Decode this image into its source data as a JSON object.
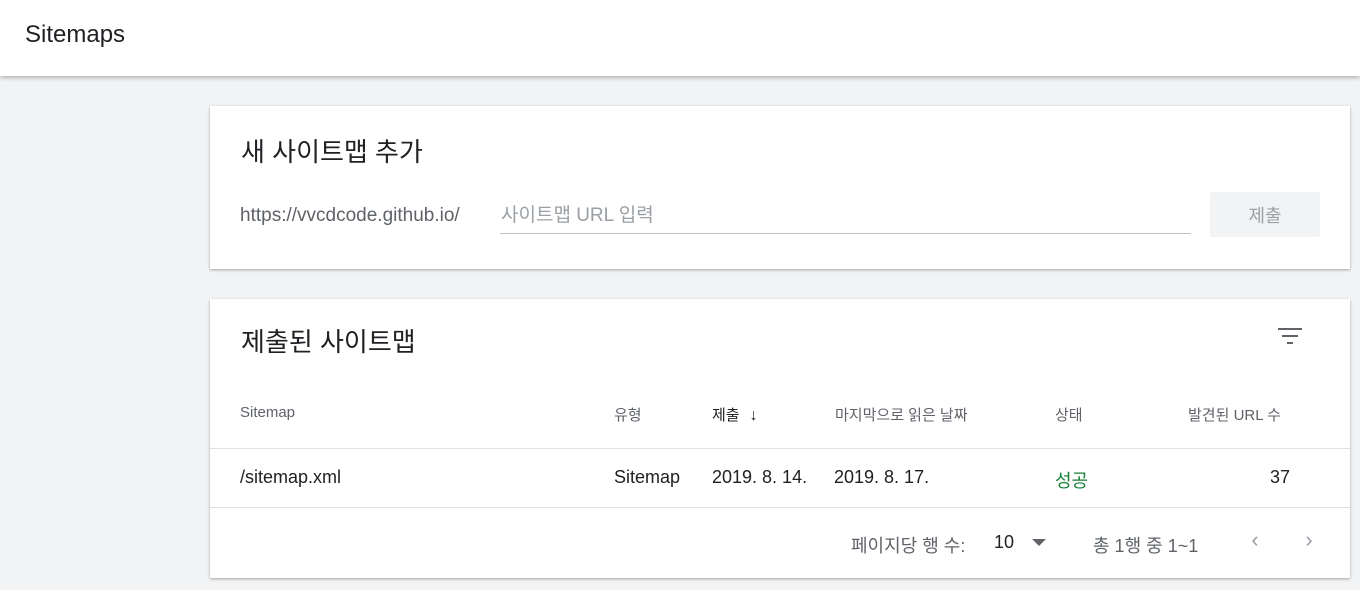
{
  "header": {
    "title": "Sitemaps"
  },
  "add_card": {
    "title": "새 사이트맵 추가",
    "url_prefix": "https://vvcdcode.github.io/",
    "input_placeholder": "사이트맵 URL 입력",
    "input_value": "",
    "submit_label": "제출"
  },
  "list_card": {
    "title": "제출된 사이트맵",
    "filter_icon": "filter-icon",
    "columns": {
      "sitemap": "Sitemap",
      "type": "유형",
      "submitted": "제출",
      "sort_arrow": "↓",
      "last_read": "마지막으로 읽은 날짜",
      "status": "상태",
      "discovered": "발견된 URL 수"
    },
    "rows": [
      {
        "sitemap": "/sitemap.xml",
        "type": "Sitemap",
        "submitted": "2019. 8. 14.",
        "last_read": "2019. 8. 17.",
        "status": "성공",
        "discovered": "37"
      }
    ],
    "footer": {
      "rows_per_page_label": "페이지당 행 수:",
      "rows_per_page_value": "10",
      "range_text": "총 1행 중 1~1",
      "prev_icon": "chevron-left-icon",
      "next_icon": "chevron-right-icon"
    }
  },
  "colors": {
    "status_success": "#188038",
    "background": "#f1f3f4"
  }
}
